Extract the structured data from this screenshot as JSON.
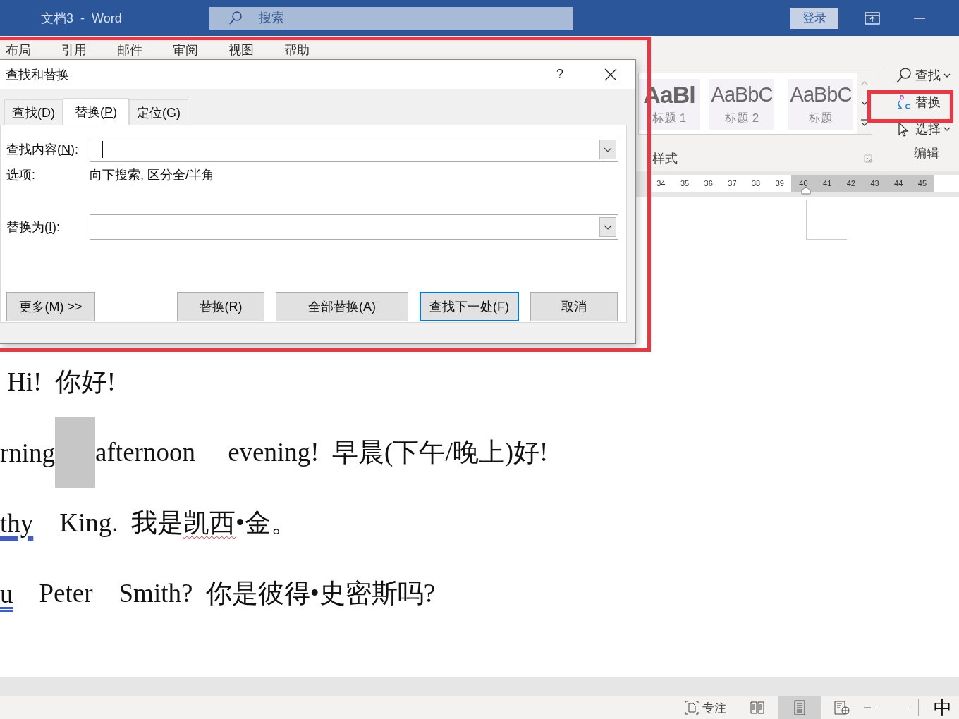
{
  "window": {
    "title": "文档3  -  Word",
    "search_placeholder": "搜索",
    "sign_in": "登录"
  },
  "ribbon": {
    "tabs": [
      "布局",
      "引用",
      "邮件",
      "审阅",
      "视图",
      "帮助"
    ],
    "styles": [
      {
        "preview": "AaBl",
        "label": "标题 1"
      },
      {
        "preview": "AaBbC",
        "label": "标题 2"
      },
      {
        "preview": "AaBbC",
        "label": "标题"
      }
    ],
    "styles_group": "样式",
    "editing": [
      {
        "label": "查找",
        "kind": "find",
        "dropdown": true
      },
      {
        "label": "替换",
        "kind": "replace",
        "dropdown": false
      },
      {
        "label": "选择",
        "kind": "select",
        "dropdown": true
      }
    ],
    "editing_group": "编辑"
  },
  "ruler": [
    {
      "n": "34",
      "margin": false
    },
    {
      "n": "35",
      "margin": false
    },
    {
      "n": "36",
      "margin": false
    },
    {
      "n": "37",
      "margin": false
    },
    {
      "n": "38",
      "margin": false
    },
    {
      "n": "39",
      "margin": false
    },
    {
      "n": "40",
      "margin": true
    },
    {
      "n": "41",
      "margin": true
    },
    {
      "n": "42",
      "margin": true
    },
    {
      "n": "43",
      "margin": true
    },
    {
      "n": "44",
      "margin": true
    },
    {
      "n": "45",
      "margin": true
    }
  ],
  "dialog": {
    "title": "查找和替换",
    "help": "?",
    "tabs": [
      {
        "before": "查找(",
        "key": "D",
        "after": ")",
        "selected": false
      },
      {
        "before": "替换(",
        "key": "P",
        "after": ")",
        "selected": true
      },
      {
        "before": "定位(",
        "key": "G",
        "after": ")",
        "selected": false
      }
    ],
    "find_label": {
      "before": "查找内容(",
      "key": "N",
      "after": "):"
    },
    "find_focused": true,
    "options_label": "选项:",
    "options_value": "向下搜索, 区分全/半角",
    "replace_label": {
      "before": "替换为(",
      "key": "I",
      "after": "):"
    },
    "buttons": [
      {
        "before": "更多(",
        "key": "M",
        "after": ") >>",
        "default": false
      },
      {
        "before": "替换(",
        "key": "R",
        "after": ")",
        "default": false
      },
      {
        "before": "全部替换(",
        "key": "A",
        "after": ")",
        "default": false
      },
      {
        "before": "查找下一处(",
        "key": "F",
        "after": ")",
        "default": true
      },
      {
        "before": "取消",
        "default": false
      }
    ]
  },
  "document": {
    "lines": [
      {
        "segments": [
          {
            "kind": "plain",
            "text": "Hi!  你好!"
          }
        ]
      },
      {
        "segments": [
          {
            "kind": "plain",
            "text": "rning"
          },
          {
            "kind": "selection"
          },
          {
            "kind": "plain",
            "text": "afternoon     evening!  早晨(下午/晚上)好!"
          }
        ]
      },
      {
        "segments": [
          {
            "kind": "grammar",
            "text": "thy"
          },
          {
            "kind": "plain",
            "text": "    King.  我是"
          },
          {
            "kind": "spelling",
            "text": "凯西"
          },
          {
            "kind": "plain",
            "text": "•金。"
          }
        ]
      },
      {
        "segments": [
          {
            "kind": "grammar",
            "text": "u"
          },
          {
            "kind": "plain",
            "text": "    Peter    Smith?  你是彼得•史密斯吗?"
          }
        ]
      }
    ]
  },
  "status": {
    "focus": "专注",
    "views": [
      {
        "kind": "read",
        "selected": false
      },
      {
        "kind": "print",
        "selected": true
      },
      {
        "kind": "web",
        "selected": false
      }
    ],
    "ime": "中"
  }
}
